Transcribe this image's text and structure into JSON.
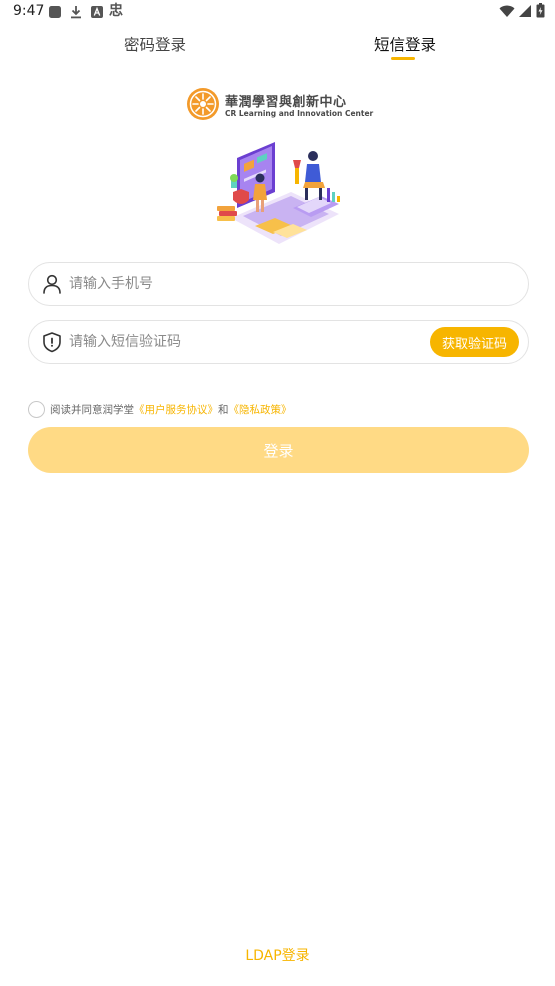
{
  "status_bar": {
    "time": "9:47",
    "left_icons": [
      "notification-square-icon",
      "download-icon",
      "translate-icon",
      "chinese-char-icon"
    ],
    "chinese_char": "忠",
    "right_icons": [
      "wifi-icon",
      "signal-icon",
      "battery-icon"
    ]
  },
  "tabs": [
    {
      "label": "密码登录",
      "active": false
    },
    {
      "label": "短信登录",
      "active": true
    }
  ],
  "logo": {
    "name": "華潤學習與創新中心",
    "subtitle": "CR Learning and Innovation Center",
    "color": "#F39A2A"
  },
  "form": {
    "phone_placeholder": "请输入手机号",
    "code_placeholder": "请输入短信验证码",
    "get_code_label": "获取验证码"
  },
  "agreement": {
    "prefix": "阅读并同意润学堂",
    "user_agreement": "《用户服务协议》",
    "connector": "和",
    "privacy_policy": "《隐私政策》"
  },
  "login_label": "登录",
  "ldap_label": "LDAP登录",
  "colors": {
    "accent": "#F7B500",
    "login_button": "#FFDA85",
    "border": "#E3E3E3"
  }
}
